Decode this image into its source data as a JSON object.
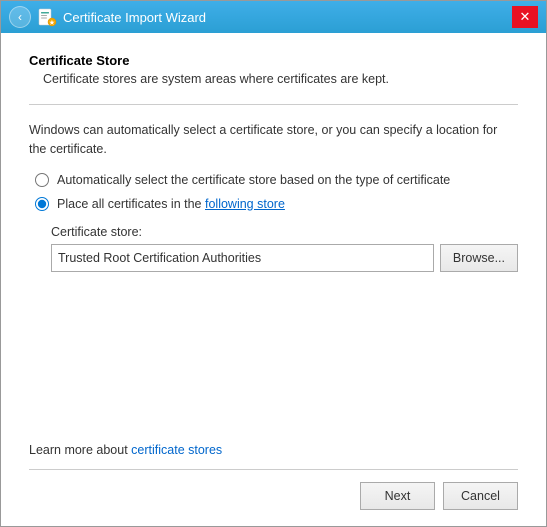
{
  "window": {
    "title": "Certificate Import Wizard",
    "close_label": "✕"
  },
  "content": {
    "section_title": "Certificate Store",
    "section_desc": "Certificate stores are system areas where certificates are kept.",
    "info_text_plain": "Windows can automatically select a certificate store,",
    "info_text_link": "or you can specify a location for the certificate.",
    "radio_auto_label": "Automatically select the certificate store based on the type of certificate",
    "radio_manual_label_plain": "Place all certificates in the",
    "radio_manual_label_link": "following store",
    "store_label": "Certificate store:",
    "store_value": "Trusted Root Certification Authorities",
    "browse_label": "Browse...",
    "learn_more_plain": "Learn more about",
    "learn_more_link": "certificate stores"
  },
  "footer": {
    "next_label": "Next",
    "cancel_label": "Cancel"
  }
}
